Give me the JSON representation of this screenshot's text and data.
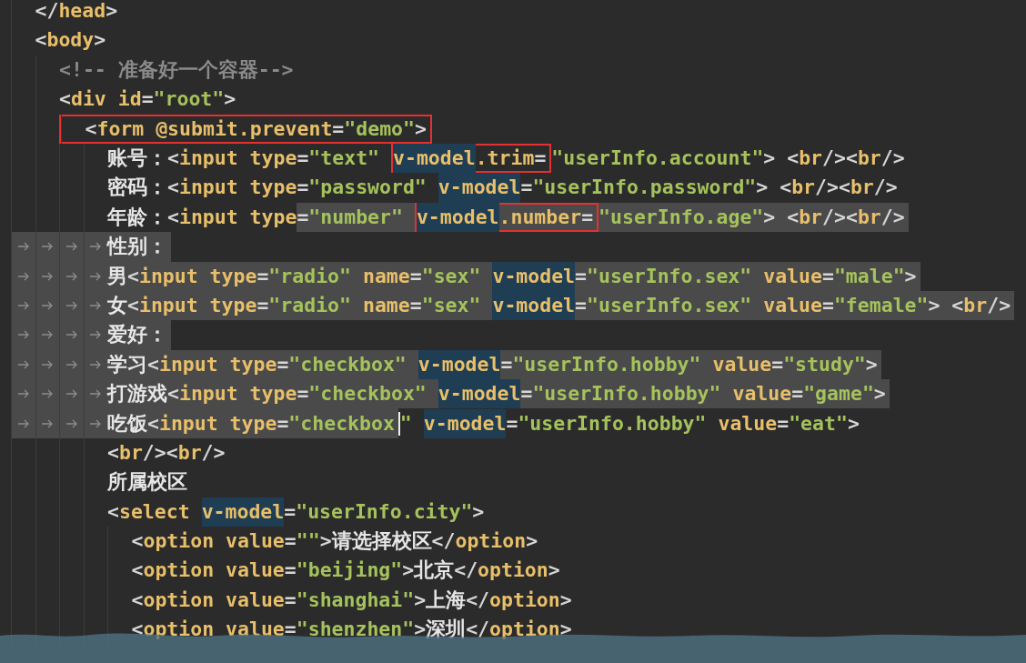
{
  "editor": {
    "lines": [
      {
        "selected": false,
        "tokens": [
          {
            "kind": "indent"
          },
          {
            "kind": "punct",
            "text": "</"
          },
          {
            "kind": "name",
            "text": "head"
          },
          {
            "kind": "punct",
            "text": ">"
          }
        ]
      },
      {
        "selected": false,
        "tokens": [
          {
            "kind": "indent"
          },
          {
            "kind": "punct",
            "text": "<"
          },
          {
            "kind": "name",
            "text": "body"
          },
          {
            "kind": "punct",
            "text": ">"
          }
        ]
      },
      {
        "selected": false,
        "tokens": [
          {
            "kind": "indent"
          },
          {
            "kind": "indent"
          },
          {
            "kind": "comment",
            "text": "<!-- 准备好一个容器-->"
          }
        ]
      },
      {
        "selected": false,
        "tokens": [
          {
            "kind": "indent"
          },
          {
            "kind": "indent"
          },
          {
            "kind": "punct",
            "text": "<"
          },
          {
            "kind": "name",
            "text": "div id"
          },
          {
            "kind": "punct",
            "text": "="
          },
          {
            "kind": "string",
            "text": "\"root\""
          },
          {
            "kind": "punct",
            "text": ">"
          }
        ]
      },
      {
        "selected": false,
        "tokens": [
          {
            "kind": "indent"
          },
          {
            "kind": "indent"
          },
          {
            "kind": "box",
            "tokens": [
              {
                "kind": "indent"
              },
              {
                "kind": "punct",
                "text": "<"
              },
              {
                "kind": "name",
                "text": "form @submit.prevent"
              },
              {
                "kind": "punct",
                "text": "="
              },
              {
                "kind": "string",
                "text": "\"demo\""
              },
              {
                "kind": "punct",
                "text": ">"
              }
            ]
          }
        ]
      },
      {
        "selected": false,
        "tokens": [
          {
            "kind": "indent"
          },
          {
            "kind": "indent"
          },
          {
            "kind": "indent"
          },
          {
            "kind": "indent"
          },
          {
            "kind": "text",
            "text": "账号："
          },
          {
            "kind": "punct",
            "text": "<"
          },
          {
            "kind": "name",
            "text": "input type"
          },
          {
            "kind": "punct",
            "text": "="
          },
          {
            "kind": "string",
            "text": "\"text\""
          },
          {
            "kind": "space"
          },
          {
            "kind": "box",
            "tokens": [
              {
                "kind": "vmodel",
                "text": "v-model"
              },
              {
                "kind": "name",
                "text": ".trim"
              },
              {
                "kind": "punct",
                "text": "="
              }
            ]
          },
          {
            "kind": "string",
            "text": "\"userInfo.account\""
          },
          {
            "kind": "punct",
            "text": "> <"
          },
          {
            "kind": "name",
            "text": "br"
          },
          {
            "kind": "punct",
            "text": "/><"
          },
          {
            "kind": "name",
            "text": "br"
          },
          {
            "kind": "punct",
            "text": "/>"
          }
        ]
      },
      {
        "selected": false,
        "tokens": [
          {
            "kind": "indent"
          },
          {
            "kind": "indent"
          },
          {
            "kind": "indent"
          },
          {
            "kind": "indent"
          },
          {
            "kind": "text",
            "text": "密码："
          },
          {
            "kind": "punct",
            "text": "<"
          },
          {
            "kind": "name",
            "text": "input type"
          },
          {
            "kind": "punct",
            "text": "="
          },
          {
            "kind": "string",
            "text": "\"password\""
          },
          {
            "kind": "space"
          },
          {
            "kind": "vmodel",
            "text": "v-model"
          },
          {
            "kind": "punct",
            "text": "="
          },
          {
            "kind": "string",
            "text": "\"userInfo.password\""
          },
          {
            "kind": "punct",
            "text": "> <"
          },
          {
            "kind": "name",
            "text": "br"
          },
          {
            "kind": "punct",
            "text": "/><"
          },
          {
            "kind": "name",
            "text": "br"
          },
          {
            "kind": "punct",
            "text": "/>"
          }
        ]
      },
      {
        "selected": false,
        "tokens": [
          {
            "kind": "indent"
          },
          {
            "kind": "indent"
          },
          {
            "kind": "indent"
          },
          {
            "kind": "indent"
          },
          {
            "kind": "text",
            "text": "年龄："
          },
          {
            "kind": "punct",
            "text": "<"
          },
          {
            "kind": "name",
            "text": "input type"
          },
          {
            "kind": "selection",
            "tokens": [
              {
                "kind": "punct",
                "text": "="
              },
              {
                "kind": "string",
                "text": "\"number\""
              },
              {
                "kind": "space"
              },
              {
                "kind": "box",
                "tokens": [
                  {
                    "kind": "vmodel",
                    "text": "v-model"
                  },
                  {
                    "kind": "name",
                    "text": ".number"
                  },
                  {
                    "kind": "punct",
                    "text": "="
                  }
                ]
              },
              {
                "kind": "string",
                "text": "\"userInfo.age\""
              },
              {
                "kind": "punct",
                "text": "> <"
              },
              {
                "kind": "name",
                "text": "br"
              },
              {
                "kind": "punct",
                "text": "/><"
              },
              {
                "kind": "name",
                "text": "br"
              },
              {
                "kind": "punct",
                "text": "/>"
              }
            ]
          }
        ]
      },
      {
        "selected": true,
        "tokens": [
          {
            "kind": "indent"
          },
          {
            "kind": "indent"
          },
          {
            "kind": "indent"
          },
          {
            "kind": "indent"
          },
          {
            "kind": "selection",
            "tokens": [
              {
                "kind": "text",
                "text": "性别："
              }
            ]
          }
        ]
      },
      {
        "selected": true,
        "tokens": [
          {
            "kind": "indent"
          },
          {
            "kind": "indent"
          },
          {
            "kind": "indent"
          },
          {
            "kind": "indent"
          },
          {
            "kind": "selection",
            "tokens": [
              {
                "kind": "text",
                "text": "男"
              },
              {
                "kind": "punct",
                "text": "<"
              },
              {
                "kind": "name",
                "text": "input type"
              },
              {
                "kind": "punct",
                "text": "="
              },
              {
                "kind": "string",
                "text": "\"radio\""
              },
              {
                "kind": "space"
              },
              {
                "kind": "name",
                "text": "name"
              },
              {
                "kind": "punct",
                "text": "="
              },
              {
                "kind": "string",
                "text": "\"sex\""
              },
              {
                "kind": "space"
              },
              {
                "kind": "vmodel",
                "text": "v-model"
              },
              {
                "kind": "punct",
                "text": "="
              },
              {
                "kind": "string",
                "text": "\"userInfo.sex\""
              },
              {
                "kind": "space"
              },
              {
                "kind": "name",
                "text": "value"
              },
              {
                "kind": "punct",
                "text": "="
              },
              {
                "kind": "string",
                "text": "\"male\""
              },
              {
                "kind": "punct",
                "text": ">"
              }
            ]
          }
        ]
      },
      {
        "selected": true,
        "tokens": [
          {
            "kind": "indent"
          },
          {
            "kind": "indent"
          },
          {
            "kind": "indent"
          },
          {
            "kind": "indent"
          },
          {
            "kind": "selection",
            "tokens": [
              {
                "kind": "text",
                "text": "女"
              },
              {
                "kind": "punct",
                "text": "<"
              },
              {
                "kind": "name",
                "text": "input type"
              },
              {
                "kind": "punct",
                "text": "="
              },
              {
                "kind": "string",
                "text": "\"radio\""
              },
              {
                "kind": "space"
              },
              {
                "kind": "name",
                "text": "name"
              },
              {
                "kind": "punct",
                "text": "="
              },
              {
                "kind": "string",
                "text": "\"sex\""
              },
              {
                "kind": "space"
              },
              {
                "kind": "vmodel",
                "text": "v-model"
              },
              {
                "kind": "punct",
                "text": "="
              },
              {
                "kind": "string",
                "text": "\"userInfo.sex\""
              },
              {
                "kind": "space"
              },
              {
                "kind": "name",
                "text": "value"
              },
              {
                "kind": "punct",
                "text": "="
              },
              {
                "kind": "string",
                "text": "\"female\""
              },
              {
                "kind": "punct",
                "text": "> <"
              },
              {
                "kind": "name",
                "text": "br"
              },
              {
                "kind": "punct",
                "text": "/>"
              }
            ]
          }
        ]
      },
      {
        "selected": true,
        "tokens": [
          {
            "kind": "indent"
          },
          {
            "kind": "indent"
          },
          {
            "kind": "indent"
          },
          {
            "kind": "indent"
          },
          {
            "kind": "selection",
            "tokens": [
              {
                "kind": "text",
                "text": "爱好："
              }
            ]
          }
        ]
      },
      {
        "selected": true,
        "tokens": [
          {
            "kind": "indent"
          },
          {
            "kind": "indent"
          },
          {
            "kind": "indent"
          },
          {
            "kind": "indent"
          },
          {
            "kind": "selection",
            "tokens": [
              {
                "kind": "text",
                "text": "学习"
              },
              {
                "kind": "punct",
                "text": "<"
              },
              {
                "kind": "name",
                "text": "input type"
              },
              {
                "kind": "punct",
                "text": "="
              },
              {
                "kind": "string",
                "text": "\"checkbox\""
              },
              {
                "kind": "space"
              },
              {
                "kind": "vmodel",
                "text": "v-model"
              },
              {
                "kind": "punct",
                "text": "="
              },
              {
                "kind": "string",
                "text": "\"userInfo.hobby\""
              },
              {
                "kind": "space"
              },
              {
                "kind": "name",
                "text": "value"
              },
              {
                "kind": "punct",
                "text": "="
              },
              {
                "kind": "string",
                "text": "\"study\""
              },
              {
                "kind": "punct",
                "text": ">"
              }
            ]
          }
        ]
      },
      {
        "selected": true,
        "tokens": [
          {
            "kind": "indent"
          },
          {
            "kind": "indent"
          },
          {
            "kind": "indent"
          },
          {
            "kind": "indent"
          },
          {
            "kind": "selection",
            "tokens": [
              {
                "kind": "text",
                "text": "打游戏"
              },
              {
                "kind": "punct",
                "text": "<"
              },
              {
                "kind": "name",
                "text": "input type"
              },
              {
                "kind": "punct",
                "text": "="
              },
              {
                "kind": "string",
                "text": "\"checkbox\""
              },
              {
                "kind": "space"
              },
              {
                "kind": "vmodel",
                "text": "v-model"
              },
              {
                "kind": "punct",
                "text": "="
              },
              {
                "kind": "string",
                "text": "\"userInfo.hobby\""
              },
              {
                "kind": "space"
              },
              {
                "kind": "name",
                "text": "value"
              },
              {
                "kind": "punct",
                "text": "="
              },
              {
                "kind": "string",
                "text": "\"game\""
              },
              {
                "kind": "punct",
                "text": ">"
              }
            ]
          }
        ]
      },
      {
        "selected": true,
        "tokens": [
          {
            "kind": "indent"
          },
          {
            "kind": "indent"
          },
          {
            "kind": "indent"
          },
          {
            "kind": "indent"
          },
          {
            "kind": "selection",
            "tokens": [
              {
                "kind": "text",
                "text": "吃饭"
              },
              {
                "kind": "punct",
                "text": "<"
              },
              {
                "kind": "name",
                "text": "input type"
              },
              {
                "kind": "punct",
                "text": "="
              },
              {
                "kind": "string",
                "text": "\"checkbox"
              }
            ]
          },
          {
            "kind": "caret"
          },
          {
            "kind": "string",
            "text": "\""
          },
          {
            "kind": "space"
          },
          {
            "kind": "vmodel",
            "text": "v-model"
          },
          {
            "kind": "punct",
            "text": "="
          },
          {
            "kind": "string",
            "text": "\"userInfo.hobby\""
          },
          {
            "kind": "space"
          },
          {
            "kind": "name",
            "text": "value"
          },
          {
            "kind": "punct",
            "text": "="
          },
          {
            "kind": "string",
            "text": "\"eat\""
          },
          {
            "kind": "punct",
            "text": ">"
          }
        ]
      },
      {
        "selected": false,
        "tokens": [
          {
            "kind": "indent"
          },
          {
            "kind": "indent"
          },
          {
            "kind": "indent"
          },
          {
            "kind": "indent"
          },
          {
            "kind": "punct",
            "text": "<"
          },
          {
            "kind": "name",
            "text": "br"
          },
          {
            "kind": "punct",
            "text": "/><"
          },
          {
            "kind": "name",
            "text": "br"
          },
          {
            "kind": "punct",
            "text": "/>"
          }
        ]
      },
      {
        "selected": false,
        "tokens": [
          {
            "kind": "indent"
          },
          {
            "kind": "indent"
          },
          {
            "kind": "indent"
          },
          {
            "kind": "indent"
          },
          {
            "kind": "text",
            "text": "所属校区"
          }
        ]
      },
      {
        "selected": false,
        "tokens": [
          {
            "kind": "indent"
          },
          {
            "kind": "indent"
          },
          {
            "kind": "indent"
          },
          {
            "kind": "indent"
          },
          {
            "kind": "punct",
            "text": "<"
          },
          {
            "kind": "name",
            "text": "select"
          },
          {
            "kind": "space"
          },
          {
            "kind": "vmodel",
            "text": "v-model"
          },
          {
            "kind": "punct",
            "text": "="
          },
          {
            "kind": "string",
            "text": "\"userInfo.city\""
          },
          {
            "kind": "punct",
            "text": ">"
          }
        ]
      },
      {
        "selected": false,
        "tokens": [
          {
            "kind": "indent"
          },
          {
            "kind": "indent"
          },
          {
            "kind": "indent"
          },
          {
            "kind": "indent"
          },
          {
            "kind": "indent"
          },
          {
            "kind": "punct",
            "text": "<"
          },
          {
            "kind": "name",
            "text": "option value"
          },
          {
            "kind": "punct",
            "text": "="
          },
          {
            "kind": "string",
            "text": "\"\""
          },
          {
            "kind": "punct",
            "text": ">"
          },
          {
            "kind": "text",
            "text": "请选择校区"
          },
          {
            "kind": "punct",
            "text": "</"
          },
          {
            "kind": "name",
            "text": "option"
          },
          {
            "kind": "punct",
            "text": ">"
          }
        ]
      },
      {
        "selected": false,
        "tokens": [
          {
            "kind": "indent"
          },
          {
            "kind": "indent"
          },
          {
            "kind": "indent"
          },
          {
            "kind": "indent"
          },
          {
            "kind": "indent"
          },
          {
            "kind": "punct",
            "text": "<"
          },
          {
            "kind": "name",
            "text": "option value"
          },
          {
            "kind": "punct",
            "text": "="
          },
          {
            "kind": "string",
            "text": "\"beijing\""
          },
          {
            "kind": "punct",
            "text": ">"
          },
          {
            "kind": "text",
            "text": "北京"
          },
          {
            "kind": "punct",
            "text": "</"
          },
          {
            "kind": "name",
            "text": "option"
          },
          {
            "kind": "punct",
            "text": ">"
          }
        ]
      },
      {
        "selected": false,
        "tokens": [
          {
            "kind": "indent"
          },
          {
            "kind": "indent"
          },
          {
            "kind": "indent"
          },
          {
            "kind": "indent"
          },
          {
            "kind": "indent"
          },
          {
            "kind": "punct",
            "text": "<"
          },
          {
            "kind": "name",
            "text": "option value"
          },
          {
            "kind": "punct",
            "text": "="
          },
          {
            "kind": "string",
            "text": "\"shanghai\""
          },
          {
            "kind": "punct",
            "text": ">"
          },
          {
            "kind": "text",
            "text": "上海"
          },
          {
            "kind": "punct",
            "text": "</"
          },
          {
            "kind": "name",
            "text": "option"
          },
          {
            "kind": "punct",
            "text": ">"
          }
        ]
      },
      {
        "selected": false,
        "tokens": [
          {
            "kind": "indent"
          },
          {
            "kind": "indent"
          },
          {
            "kind": "indent"
          },
          {
            "kind": "indent"
          },
          {
            "kind": "indent"
          },
          {
            "kind": "punct",
            "text": "<"
          },
          {
            "kind": "name",
            "text": "option value"
          },
          {
            "kind": "punct",
            "text": "="
          },
          {
            "kind": "string",
            "text": "\"shenzhen\""
          },
          {
            "kind": "punct",
            "text": ">"
          },
          {
            "kind": "text",
            "text": "深圳"
          },
          {
            "kind": "punct",
            "text": "</"
          },
          {
            "kind": "name",
            "text": "option"
          },
          {
            "kind": "punct",
            "text": ">"
          }
        ]
      }
    ]
  }
}
